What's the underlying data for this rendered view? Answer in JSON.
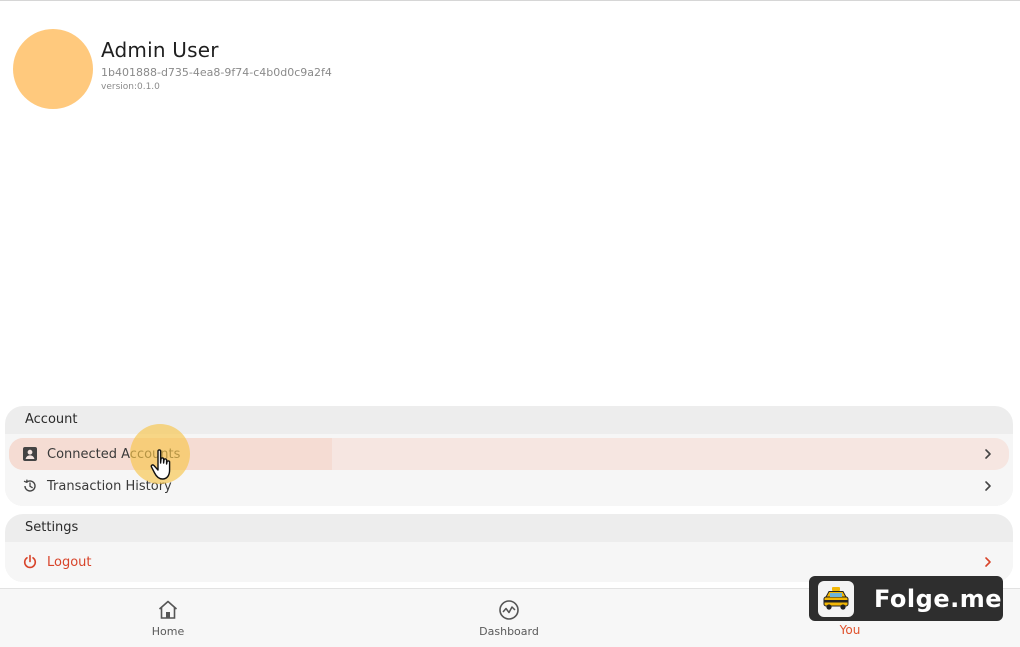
{
  "profile": {
    "name": "Admin User",
    "user_id": "1b401888-d735-4ea8-9f74-c4b0d0c9a2f4",
    "version": "version:0.1.0",
    "avatar_color": "#ffc97d"
  },
  "sections": {
    "account": {
      "title": "Account",
      "items": [
        {
          "label": "Connected Accounts",
          "icon": "account-box-icon"
        },
        {
          "label": "Transaction History",
          "icon": "history-icon"
        }
      ]
    },
    "settings": {
      "title": "Settings",
      "items": [
        {
          "label": "Logout",
          "icon": "power-icon"
        }
      ]
    }
  },
  "bottom_nav": {
    "items": [
      {
        "label": "Home",
        "icon": "home-icon"
      },
      {
        "label": "Dashboard",
        "icon": "dashboard-icon"
      },
      {
        "label": "You",
        "icon": "you-icon",
        "active": true
      }
    ]
  },
  "watermark": {
    "text": "Folge.me"
  },
  "colors": {
    "accent": "#e0522c",
    "danger": "#d8442a",
    "highlight": "#f5dcd3"
  }
}
